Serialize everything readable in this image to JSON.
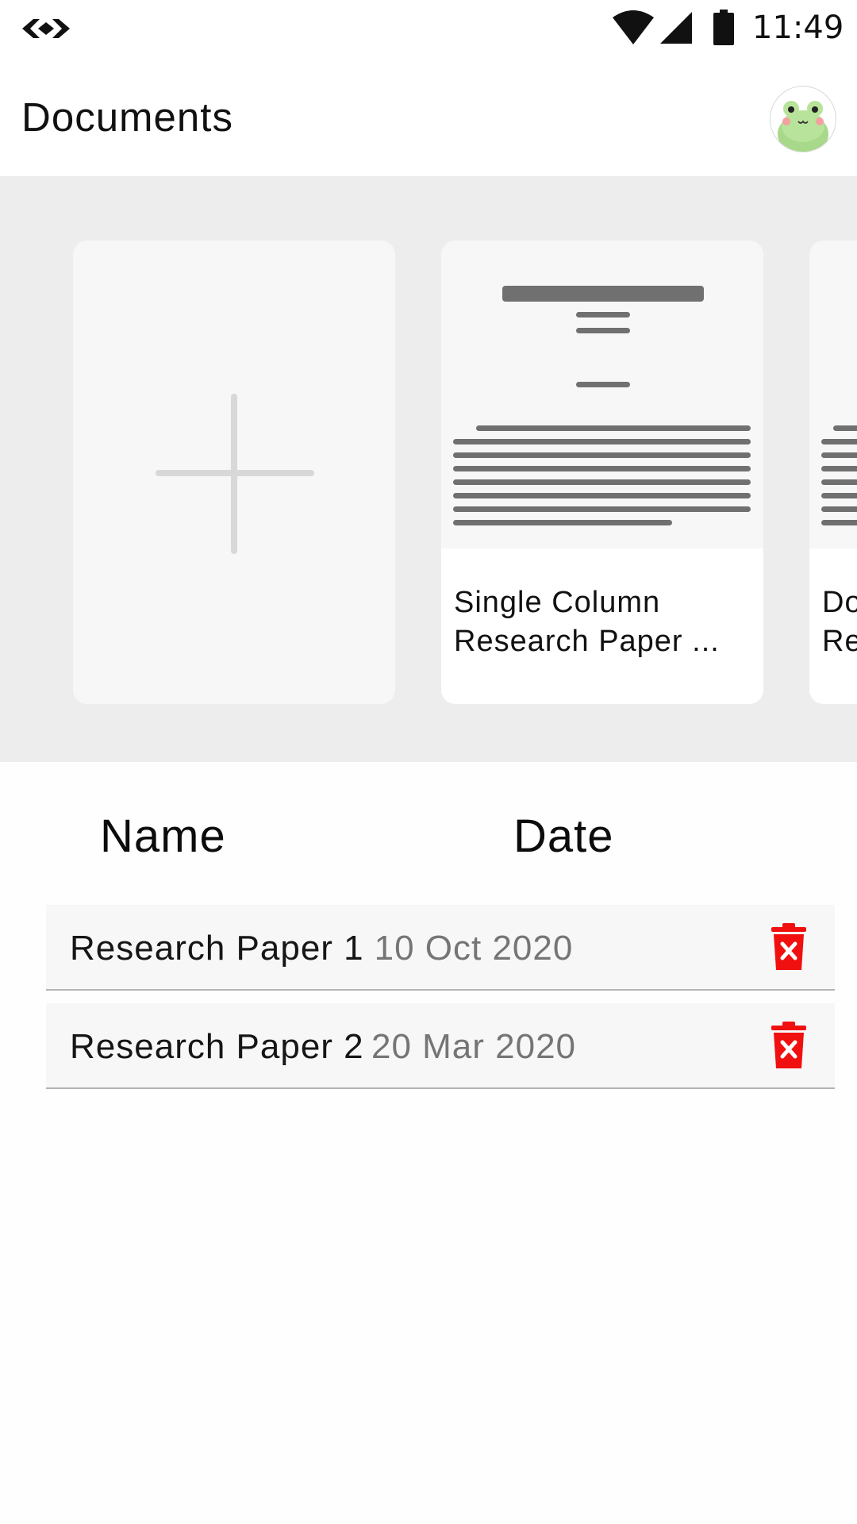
{
  "status_bar": {
    "time": "11:49",
    "icons": [
      "code-logo-icon",
      "wifi-icon",
      "cell-signal-icon",
      "battery-icon"
    ]
  },
  "app_bar": {
    "title": "Documents",
    "avatar": "frog-avatar"
  },
  "templates": [
    {
      "type": "new",
      "icon": "plus-icon"
    },
    {
      "type": "template",
      "label_line1": "Single Column",
      "label_line2": "Research Paper ..."
    },
    {
      "type": "template",
      "label_line1": "Do",
      "label_line2": "Re"
    }
  ],
  "table": {
    "headers": {
      "name": "Name",
      "date": "Date"
    },
    "rows": [
      {
        "name": "Research Paper 1",
        "date": "10 Oct 2020",
        "action_icon": "trash-delete-icon"
      },
      {
        "name": "Research Paper 2",
        "date": "20 Mar 2020",
        "action_icon": "trash-delete-icon"
      }
    ]
  },
  "colors": {
    "accent_delete": "#f01010",
    "panel_bg": "#ededed",
    "card_bg": "#f7f7f7",
    "preview_lines": "#707070",
    "date_text": "#757575"
  }
}
